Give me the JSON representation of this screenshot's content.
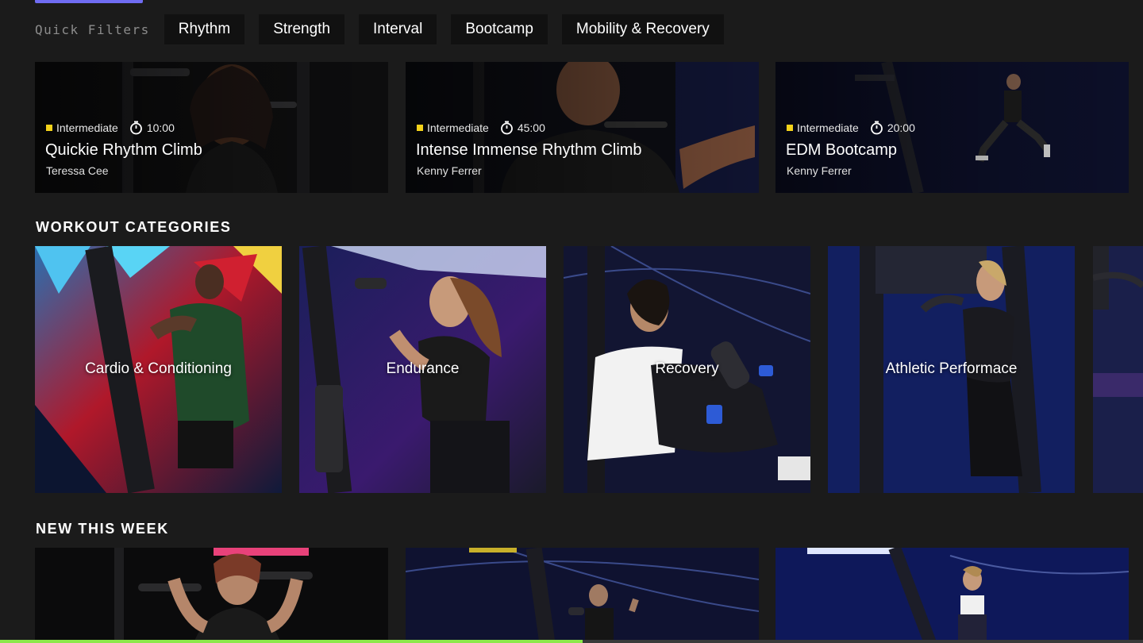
{
  "quick_filters": {
    "label": "Quick Filters",
    "chips": [
      "Rhythm",
      "Strength",
      "Interval",
      "Bootcamp",
      "Mobility & Recovery"
    ]
  },
  "classes": [
    {
      "level": "Intermediate",
      "duration": "10:00",
      "title": "Quickie Rhythm Climb",
      "coach": "Teressa Cee"
    },
    {
      "level": "Intermediate",
      "duration": "45:00",
      "title": "Intense Immense Rhythm Climb",
      "coach": "Kenny Ferrer"
    },
    {
      "level": "Intermediate",
      "duration": "20:00",
      "title": "EDM Bootcamp",
      "coach": "Kenny Ferrer"
    }
  ],
  "workout_categories": {
    "heading": "WORKOUT CATEGORIES",
    "tiles": [
      "Cardio & Conditioning",
      "Endurance",
      "Recovery",
      "Athletic Performace"
    ]
  },
  "new_this_week": {
    "heading": "NEW THIS WEEK"
  },
  "colors": {
    "background": "#1b1b1b",
    "chip_bg": "#111111",
    "level_badge": "#f3d21a",
    "accent_top": "#6f6cf2",
    "progress": "#8be84a"
  },
  "scroll_progress": 0.51,
  "icons": [
    "timer-icon",
    "level-indicator-icon"
  ]
}
